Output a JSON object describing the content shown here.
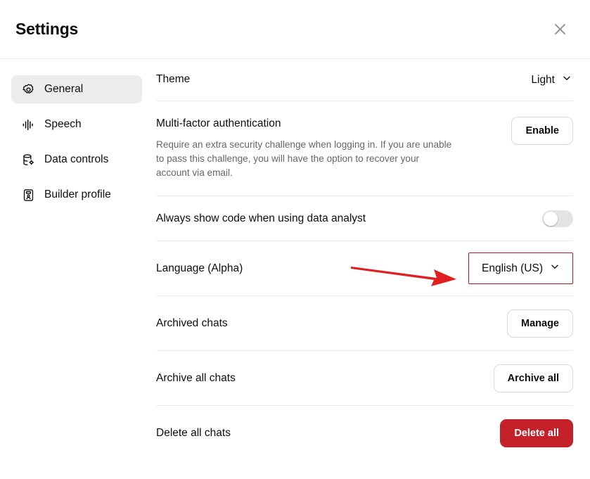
{
  "header": {
    "title": "Settings",
    "close_icon": "close-icon"
  },
  "sidebar": {
    "items": [
      {
        "label": "General",
        "icon": "gear-icon",
        "active": true
      },
      {
        "label": "Speech",
        "icon": "waveform-icon",
        "active": false
      },
      {
        "label": "Data controls",
        "icon": "database-gear-icon",
        "active": false
      },
      {
        "label": "Builder profile",
        "icon": "id-card-icon",
        "active": false
      }
    ]
  },
  "main": {
    "rows": {
      "theme": {
        "label": "Theme",
        "value": "Light",
        "chevron_icon": "chevron-down-icon"
      },
      "mfa": {
        "label": "Multi-factor authentication",
        "description": "Require an extra security challenge when logging in. If you are unable to pass this challenge, you will have the option to recover your account via email.",
        "button": "Enable"
      },
      "show_code": {
        "label": "Always show code when using data analyst",
        "toggle_state": "off"
      },
      "language": {
        "label": "Language (Alpha)",
        "value": "English (US)",
        "chevron_icon": "chevron-down-icon",
        "highlighted": true
      },
      "archived_chats": {
        "label": "Archived chats",
        "button": "Manage"
      },
      "archive_all": {
        "label": "Archive all chats",
        "button": "Archive all"
      },
      "delete_all": {
        "label": "Delete all chats",
        "button": "Delete all"
      }
    }
  },
  "annotation": {
    "arrow_icon": "red-arrow-right-icon",
    "arrow_color": "#e02020",
    "highlight_color": "#a81a24"
  },
  "colors": {
    "danger": "#c4202a",
    "active_nav_bg": "#ececec",
    "divider": "#ececec",
    "muted_text": "#666666"
  }
}
